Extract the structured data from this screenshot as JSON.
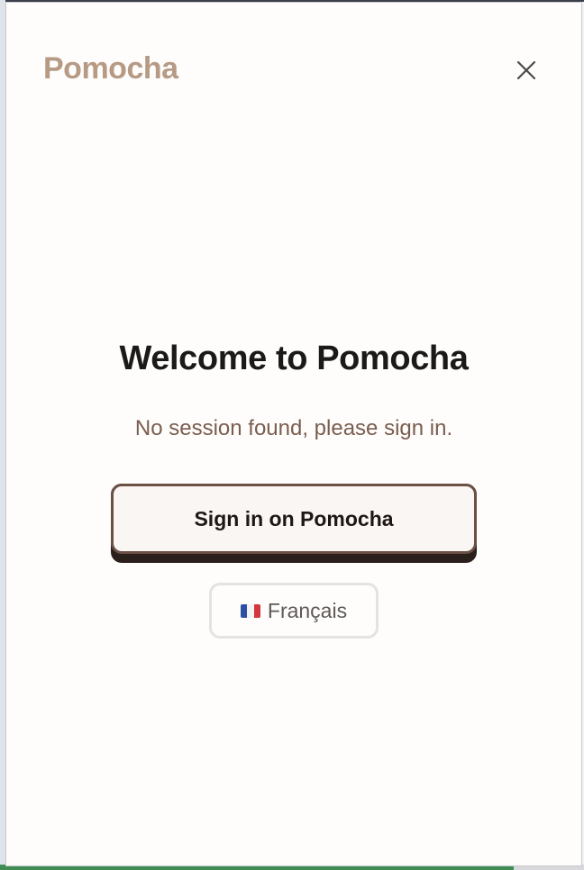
{
  "popup": {
    "brand": "Pomocha",
    "close_icon": "close-icon"
  },
  "welcome": {
    "title": "Welcome to Pomocha",
    "subtitle": "No session found, please sign in.",
    "signin_label": "Sign in on Pomocha"
  },
  "language": {
    "flag_icon": "france-flag-icon",
    "label": "Français"
  },
  "colors": {
    "brand": "#b79a84",
    "title": "#1c1a19",
    "subtitle": "#7a5d4f",
    "button_border": "#6b5045",
    "button_bg": "#faf6f4"
  }
}
